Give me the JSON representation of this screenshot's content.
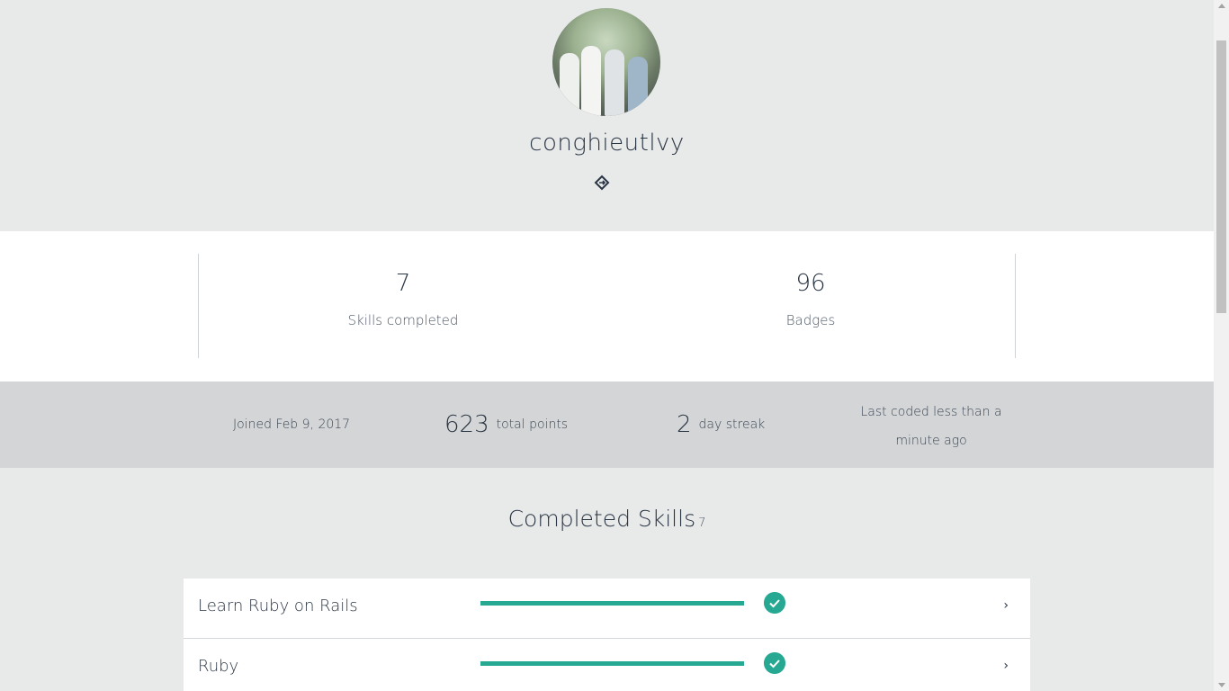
{
  "profile": {
    "username": "conghieutlvy",
    "share_icon": "share-icon"
  },
  "stats": [
    {
      "value": "7",
      "label": "Skills completed"
    },
    {
      "value": "96",
      "label": "Badges"
    }
  ],
  "info": {
    "joined": "Joined Feb 9, 2017",
    "points_value": "623",
    "points_label": "total points",
    "streak_value": "2",
    "streak_label": "day streak",
    "last_coded": "Last coded less than a minute ago"
  },
  "skills": {
    "title": "Completed Skills",
    "count": "7",
    "items": [
      {
        "name": "Learn Ruby on Rails",
        "progress": 1.0,
        "completed": true
      },
      {
        "name": "Ruby",
        "progress": 1.0,
        "completed": true
      }
    ]
  },
  "colors": {
    "accent": "#27a893",
    "header_bg": "#e8e9e9",
    "info_bg": "#d3d5d6",
    "text": "#2a3544"
  }
}
